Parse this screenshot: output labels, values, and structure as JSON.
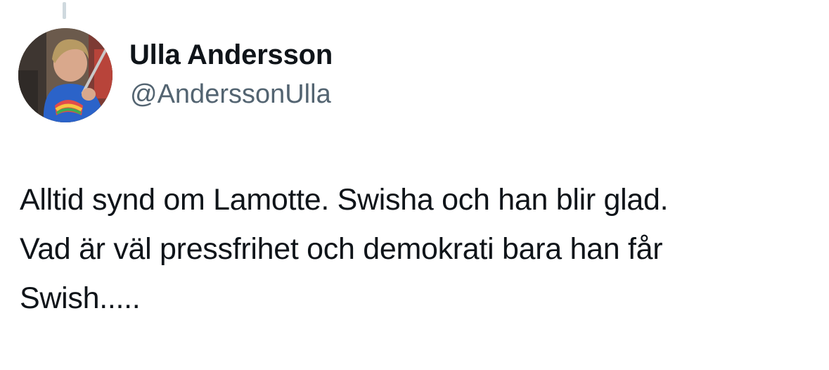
{
  "tweet": {
    "author": {
      "display_name": "Ulla Andersson",
      "handle": "@AnderssonUlla"
    },
    "text_lines": [
      "Alltid synd om Lamotte. Swisha och han blir glad.",
      "Vad är väl pressfrihet och demokrati bara han får",
      "Swish....."
    ]
  }
}
